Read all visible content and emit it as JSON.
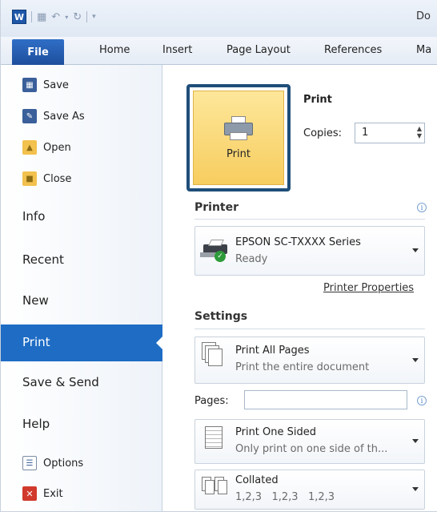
{
  "titlebar": {
    "app_logo": "W",
    "doc_title": "Do",
    "qat_icons": [
      "save-icon",
      "undo-icon",
      "redo-icon",
      "customize-icon"
    ]
  },
  "ribbon": {
    "file_tab": "File",
    "tabs": [
      "Home",
      "Insert",
      "Page Layout",
      "References",
      "Ma"
    ]
  },
  "backstage": {
    "commands": [
      {
        "label": "Save",
        "icon": "save-icon"
      },
      {
        "label": "Save As",
        "icon": "save-as-icon"
      },
      {
        "label": "Open",
        "icon": "open-folder-icon"
      },
      {
        "label": "Close",
        "icon": "close-folder-icon"
      }
    ],
    "nav": [
      "Info",
      "Recent",
      "New",
      "Print",
      "Save & Send",
      "Help"
    ],
    "selected_nav": "Print",
    "bottom": [
      {
        "label": "Options",
        "icon": "options-icon"
      },
      {
        "label": "Exit",
        "icon": "exit-icon"
      }
    ]
  },
  "print_panel": {
    "print_button_label": "Print",
    "heading": "Print",
    "copies_label": "Copies:",
    "copies_value": "1",
    "printer_heading": "Printer",
    "printer_name": "EPSON SC-TXXXX Series",
    "printer_status": "Ready",
    "printer_properties_link": "Printer Properties",
    "settings_heading": "Settings",
    "pages_dropdown": {
      "title": "Print All Pages",
      "subtitle": "Print the entire document"
    },
    "pages_label": "Pages:",
    "pages_value": "",
    "sided_dropdown": {
      "title": "Print One Sided",
      "subtitle": "Only print on one side of th..."
    },
    "collate_dropdown": {
      "title": "Collated",
      "subtitle": "1,2,3   1,2,3   1,2,3"
    }
  },
  "colors": {
    "accent": "#1e6cc4",
    "print_button_fill": "#f9d775",
    "print_button_border": "#1f4e79",
    "status_ok": "#2e9b3a"
  }
}
